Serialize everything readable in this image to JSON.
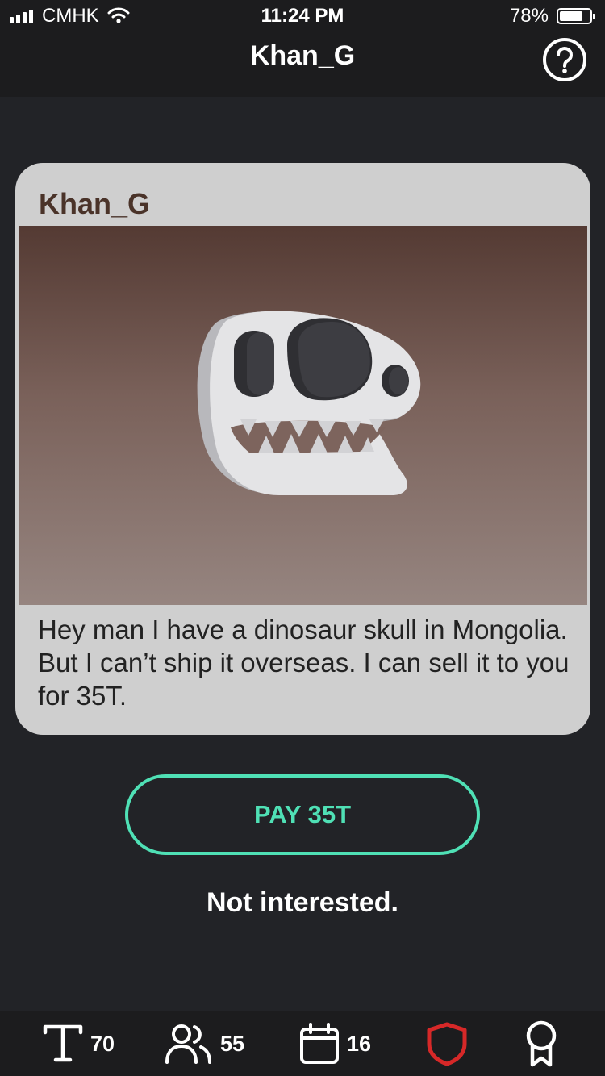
{
  "status_bar": {
    "carrier": "CMHK",
    "time": "11:24 PM",
    "battery_percent": "78%",
    "battery_level": 0.78
  },
  "header": {
    "title": "Khan_G",
    "help_icon": "question-circle-icon"
  },
  "card": {
    "username": "Khan_G",
    "image_icon": "dinosaur-skull-icon",
    "message": "Hey man I have a dinosaur skull in Mongolia. But I can’t ship it overseas. I can sell it to you for 35T."
  },
  "actions": {
    "pay_label": "PAY 35T",
    "decline_label": "Not interested."
  },
  "tabbar": {
    "tokens": {
      "icon": "token-t-icon",
      "value": "70"
    },
    "followers": {
      "icon": "people-icon",
      "value": "55"
    },
    "days": {
      "icon": "calendar-icon",
      "value": "16"
    },
    "security": {
      "icon": "shield-icon"
    },
    "achievements": {
      "icon": "award-ribbon-icon"
    }
  },
  "colors": {
    "accent": "#4fe0b5",
    "shield": "#d62828",
    "background": "#222327",
    "card": "#cfcfcf"
  }
}
